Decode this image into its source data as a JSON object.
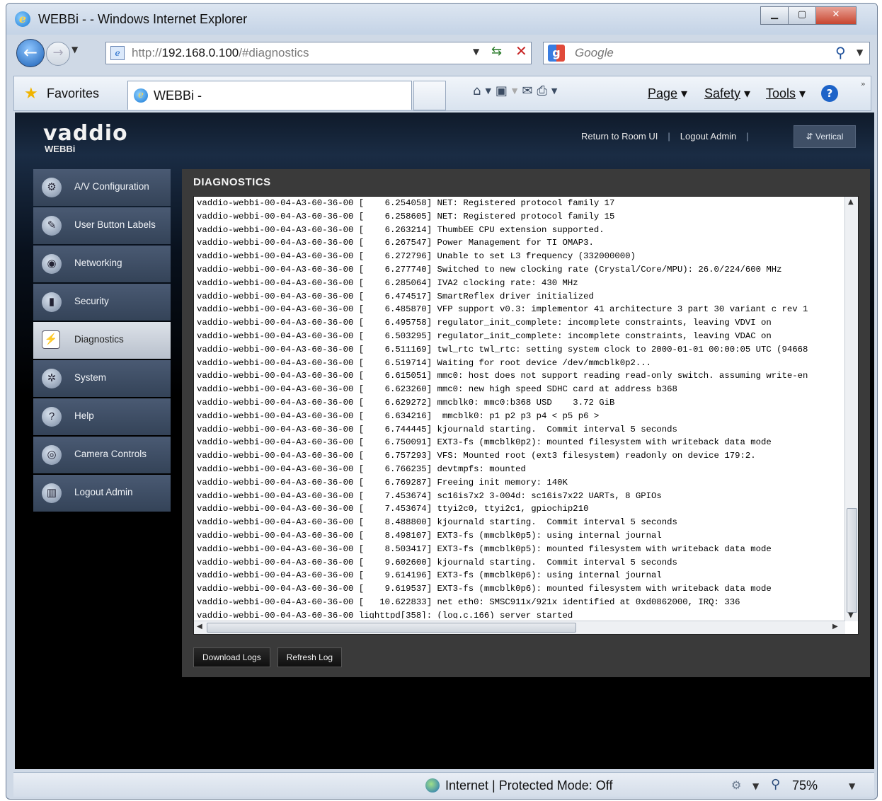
{
  "browser": {
    "window_title": "WEBBi - - Windows Internet Explorer",
    "window_buttons": {
      "minimize": "▁",
      "maximize": "▢",
      "close": "✕"
    },
    "address": {
      "prefix": "http://",
      "host": "192.168.0.100",
      "path": "/#diagnostics"
    },
    "search": {
      "placeholder": "Google"
    },
    "favorites_label": "Favorites",
    "tab_title": "WEBBi -",
    "command_menus": [
      {
        "label": "Page"
      },
      {
        "label": "Safety"
      },
      {
        "label": "Tools"
      }
    ],
    "status": {
      "zone": "Internet | Protected Mode: Off",
      "zoom": "75%"
    }
  },
  "app": {
    "brand": "vaddio",
    "brand_sub": "WEBBi",
    "top_links": {
      "return": "Return to Room UI",
      "logout": "Logout Admin",
      "vertical": "Vertical"
    },
    "sidebar": [
      {
        "label": "A/V Configuration",
        "icon": "av-config-icon",
        "glyph": "⚙",
        "active": false
      },
      {
        "label": "User Button Labels",
        "icon": "pen-icon",
        "glyph": "✎",
        "active": false
      },
      {
        "label": "Networking",
        "icon": "network-icon",
        "glyph": "◉",
        "active": false
      },
      {
        "label": "Security",
        "icon": "lock-icon",
        "glyph": "▮",
        "active": false
      },
      {
        "label": "Diagnostics",
        "icon": "diagnostics-icon",
        "glyph": "⚡",
        "active": true
      },
      {
        "label": "System",
        "icon": "system-icon",
        "glyph": "✲",
        "active": false
      },
      {
        "label": "Help",
        "icon": "help-icon",
        "glyph": "?",
        "active": false
      },
      {
        "label": "Camera Controls",
        "icon": "camera-controls-icon",
        "glyph": "◎",
        "active": false
      },
      {
        "label": "Logout Admin",
        "icon": "logout-icon",
        "glyph": "▥",
        "active": false
      }
    ],
    "panel_title": "DIAGNOSTICS",
    "log_lines": [
      "vaddio-webbi-00-04-A3-60-36-00 [    6.254058] NET: Registered protocol family 17",
      "vaddio-webbi-00-04-A3-60-36-00 [    6.258605] NET: Registered protocol family 15",
      "vaddio-webbi-00-04-A3-60-36-00 [    6.263214] ThumbEE CPU extension supported.",
      "vaddio-webbi-00-04-A3-60-36-00 [    6.267547] Power Management for TI OMAP3.",
      "vaddio-webbi-00-04-A3-60-36-00 [    6.272796] Unable to set L3 frequency (332000000)",
      "vaddio-webbi-00-04-A3-60-36-00 [    6.277740] Switched to new clocking rate (Crystal/Core/MPU): 26.0/224/600 MHz",
      "vaddio-webbi-00-04-A3-60-36-00 [    6.285064] IVA2 clocking rate: 430 MHz",
      "vaddio-webbi-00-04-A3-60-36-00 [    6.474517] SmartReflex driver initialized",
      "vaddio-webbi-00-04-A3-60-36-00 [    6.485870] VFP support v0.3: implementor 41 architecture 3 part 30 variant c rev 1",
      "vaddio-webbi-00-04-A3-60-36-00 [    6.495758] regulator_init_complete: incomplete constraints, leaving VDVI on",
      "vaddio-webbi-00-04-A3-60-36-00 [    6.503295] regulator_init_complete: incomplete constraints, leaving VDAC on",
      "vaddio-webbi-00-04-A3-60-36-00 [    6.511169] twl_rtc twl_rtc: setting system clock to 2000-01-01 00:00:05 UTC (94668",
      "vaddio-webbi-00-04-A3-60-36-00 [    6.519714] Waiting for root device /dev/mmcblk0p2...",
      "vaddio-webbi-00-04-A3-60-36-00 [    6.615051] mmc0: host does not support reading read-only switch. assuming write-en",
      "vaddio-webbi-00-04-A3-60-36-00 [    6.623260] mmc0: new high speed SDHC card at address b368",
      "vaddio-webbi-00-04-A3-60-36-00 [    6.629272] mmcblk0: mmc0:b368 USD    3.72 GiB",
      "vaddio-webbi-00-04-A3-60-36-00 [    6.634216]  mmcblk0: p1 p2 p3 p4 < p5 p6 >",
      "vaddio-webbi-00-04-A3-60-36-00 [    6.744445] kjournald starting.  Commit interval 5 seconds",
      "vaddio-webbi-00-04-A3-60-36-00 [    6.750091] EXT3-fs (mmcblk0p2): mounted filesystem with writeback data mode",
      "vaddio-webbi-00-04-A3-60-36-00 [    6.757293] VFS: Mounted root (ext3 filesystem) readonly on device 179:2.",
      "vaddio-webbi-00-04-A3-60-36-00 [    6.766235] devtmpfs: mounted",
      "vaddio-webbi-00-04-A3-60-36-00 [    6.769287] Freeing init memory: 140K",
      "vaddio-webbi-00-04-A3-60-36-00 [    7.453674] sc16is7x2 3-004d: sc16is7x22 UARTs, 8 GPIOs",
      "vaddio-webbi-00-04-A3-60-36-00 [    7.453674] ttyi2c0, ttyi2c1, gpiochip210",
      "vaddio-webbi-00-04-A3-60-36-00 [    8.488800] kjournald starting.  Commit interval 5 seconds",
      "vaddio-webbi-00-04-A3-60-36-00 [    8.498107] EXT3-fs (mmcblk0p5): using internal journal",
      "vaddio-webbi-00-04-A3-60-36-00 [    8.503417] EXT3-fs (mmcblk0p5): mounted filesystem with writeback data mode",
      "vaddio-webbi-00-04-A3-60-36-00 [    9.602600] kjournald starting.  Commit interval 5 seconds",
      "vaddio-webbi-00-04-A3-60-36-00 [    9.614196] EXT3-fs (mmcblk0p6): using internal journal",
      "vaddio-webbi-00-04-A3-60-36-00 [    9.619537] EXT3-fs (mmcblk0p6): mounted filesystem with writeback data mode",
      "vaddio-webbi-00-04-A3-60-36-00 [   10.622833] net eth0: SMSC911x/921x identified at 0xd0862000, IRQ: 336",
      "vaddio-webbi-00-04-A3-60-36-00 lighttpd[358]: (log.c.166) server started"
    ],
    "buttons": {
      "download": "Download Logs",
      "refresh": "Refresh Log"
    }
  }
}
